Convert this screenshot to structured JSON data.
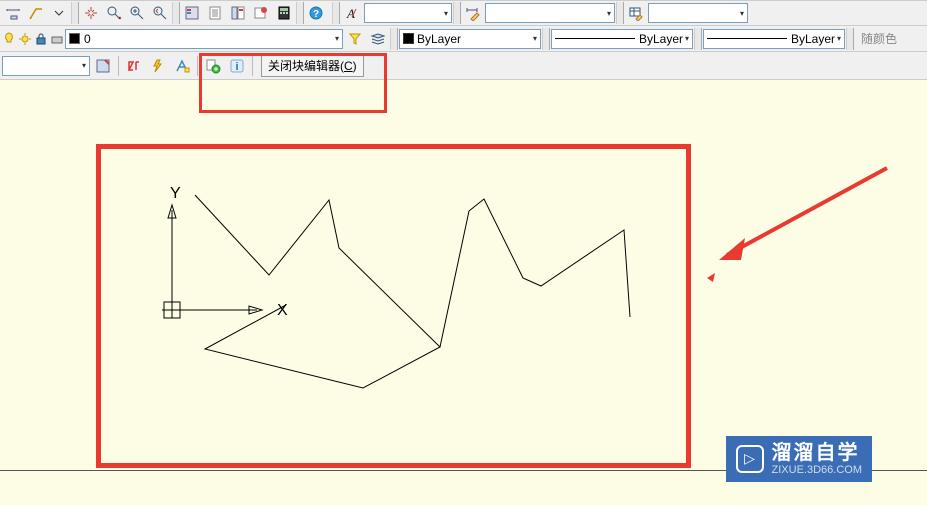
{
  "toolbar": {
    "layer": {
      "current": "0"
    },
    "linetype": {
      "selected": "ByLayer"
    },
    "lineweight": {
      "selected": "ByLayer"
    },
    "plotstyle": {
      "selected": "ByLayer"
    },
    "color_label": "随颜色"
  },
  "blockeditor": {
    "close_label_prefix": "关闭块编辑器(",
    "close_label_key": "C",
    "close_label_suffix": ")"
  },
  "ucs": {
    "x": "X",
    "y": "Y"
  },
  "brand": {
    "title": "溜溜自学",
    "sub": "ZIXUE.3D66.COM",
    "play": "▷"
  }
}
